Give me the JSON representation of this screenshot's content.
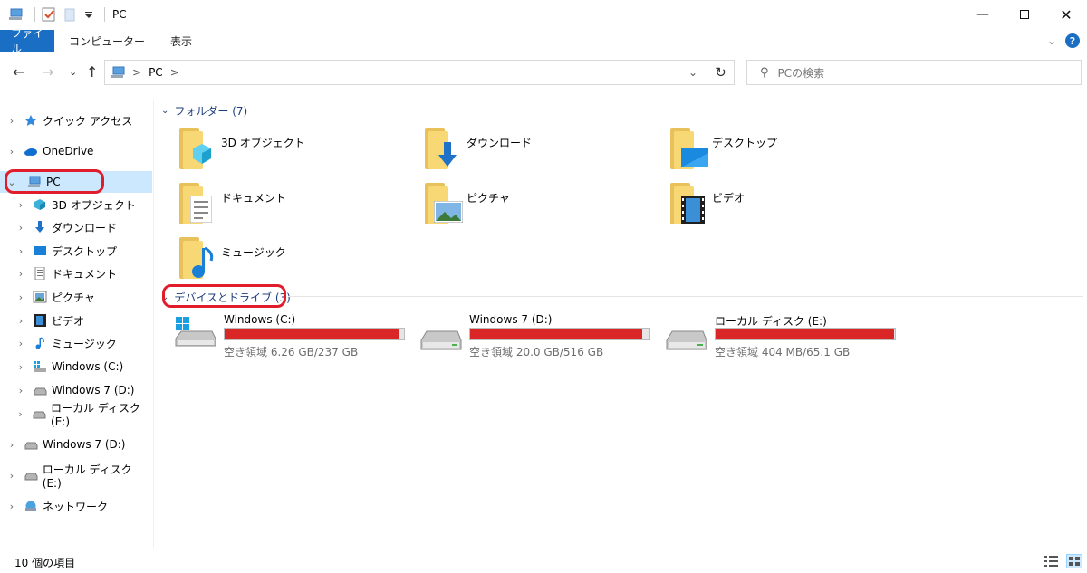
{
  "window": {
    "title": "PC"
  },
  "ribbon": {
    "tabs": [
      "ファイル",
      "コンピューター",
      "表示"
    ],
    "help": "?"
  },
  "address": {
    "crumb": "PC",
    "sep": ">"
  },
  "search": {
    "placeholder": "PCの検索"
  },
  "sidebar": {
    "items": [
      {
        "label": "クイック アクセス"
      },
      {
        "label": "OneDrive"
      },
      {
        "label": "PC"
      },
      {
        "label": "3D オブジェクト"
      },
      {
        "label": "ダウンロード"
      },
      {
        "label": "デスクトップ"
      },
      {
        "label": "ドキュメント"
      },
      {
        "label": "ピクチャ"
      },
      {
        "label": "ビデオ"
      },
      {
        "label": "ミュージック"
      },
      {
        "label": "Windows (C:)"
      },
      {
        "label": "Windows 7 (D:)"
      },
      {
        "label": "ローカル ディスク (E:)"
      },
      {
        "label": "Windows 7 (D:)"
      },
      {
        "label": "ローカル ディスク (E:)"
      },
      {
        "label": "ネットワーク"
      }
    ]
  },
  "folders": {
    "header": "フォルダー (7)",
    "items": [
      {
        "label": "3D オブジェクト"
      },
      {
        "label": "ダウンロード"
      },
      {
        "label": "デスクトップ"
      },
      {
        "label": "ドキュメント"
      },
      {
        "label": "ピクチャ"
      },
      {
        "label": "ビデオ"
      },
      {
        "label": "ミュージック"
      }
    ]
  },
  "drives": {
    "header": "デバイスとドライブ (3)",
    "items": [
      {
        "name": "Windows (C:)",
        "free": "空き領域 6.26 GB/237 GB",
        "used_fraction": 0.974
      },
      {
        "name": "Windows 7 (D:)",
        "free": "空き領域 20.0 GB/516 GB",
        "used_fraction": 0.961
      },
      {
        "name": "ローカル ディスク (E:)",
        "free": "空き領域 404 MB/65.1 GB",
        "used_fraction": 0.994
      }
    ]
  },
  "status": {
    "count": "10 個の項目"
  },
  "colors": {
    "accent": "#1a6fc4",
    "selection": "#cce8ff",
    "highlight_ring": "#e11d2c",
    "drive_bar": "#da2626",
    "group_header": "#1e3d7b"
  }
}
